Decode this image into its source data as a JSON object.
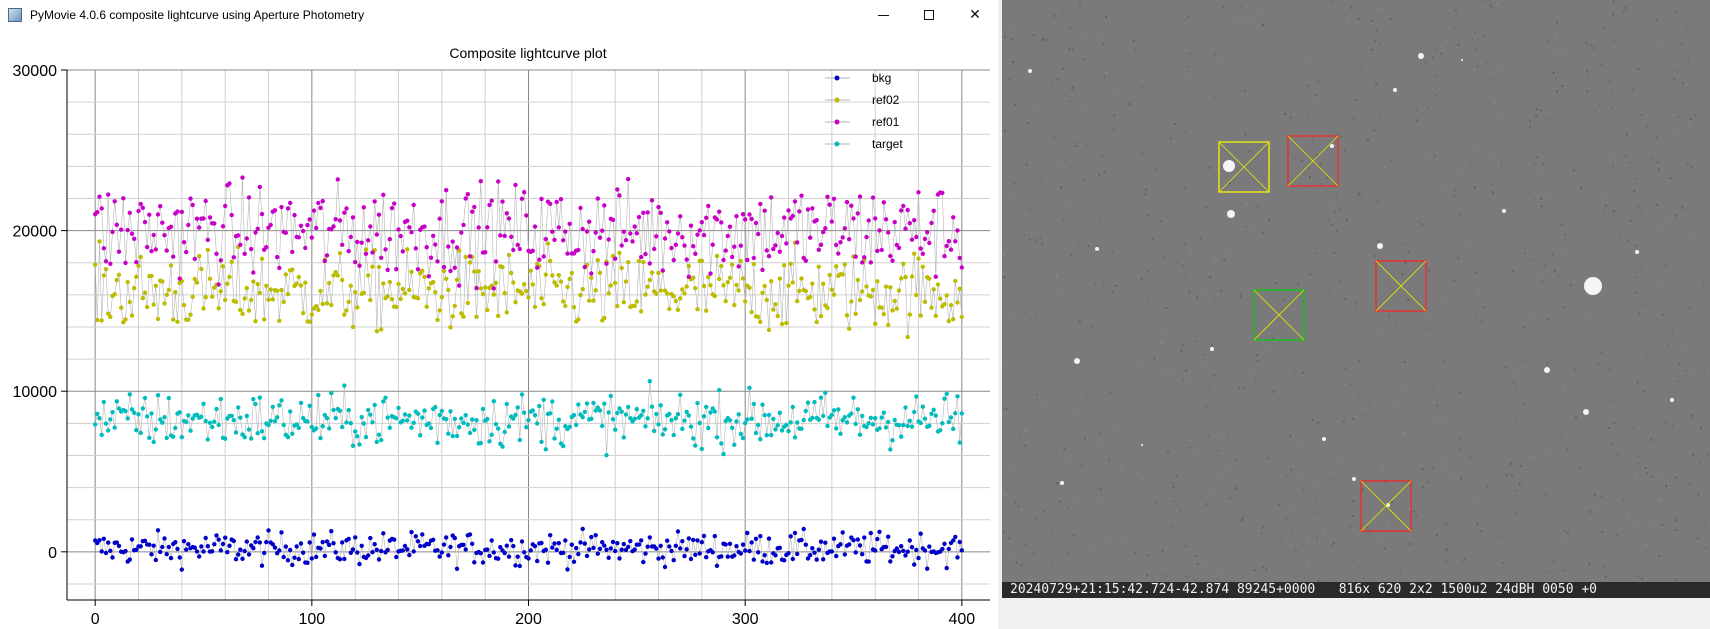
{
  "window": {
    "title": "PyMovie 4.0.6 composite lightcurve using Aperture Photometry",
    "controls": {
      "minimize": "minimize",
      "maximize": "maximize",
      "close": "✕"
    }
  },
  "chart_data": {
    "type": "scatter",
    "title": "Composite lightcurve plot",
    "xlabel": "",
    "ylabel": "",
    "xlim": [
      -13,
      413
    ],
    "ylim": [
      -3000,
      30000
    ],
    "x_ticks": [
      "0",
      "100",
      "200",
      "300",
      "400"
    ],
    "y_ticks": [
      "0",
      "10000",
      "20000",
      "30000"
    ],
    "grid": true,
    "legend_position": "top-right",
    "series": [
      {
        "name": "bkg",
        "color": "#0000c8",
        "y_min": -1500,
        "y_max": 3100,
        "mean": 200,
        "spread": 900
      },
      {
        "name": "ref02",
        "color": "#bcbc00",
        "y_min": 11000,
        "y_max": 22000,
        "mean": 16200,
        "spread": 2200
      },
      {
        "name": "ref01",
        "color": "#c800c8",
        "y_min": 14000,
        "y_max": 26500,
        "mean": 20000,
        "spread": 2600
      },
      {
        "name": "target",
        "color": "#00bcbc",
        "y_min": 4000,
        "y_max": 12500,
        "mean": 8200,
        "spread": 1500
      }
    ],
    "n_points": 401
  },
  "image": {
    "statusline": "20240729+21:15:42.724-42.874 89245+0000   816x 620 2x2 1500u2 24dBH 0050 +0",
    "apertures": [
      {
        "name": "ref",
        "color": "#ffff00"
      },
      {
        "name": "bkg-1",
        "color": "#ff2020"
      },
      {
        "name": "bkg-2",
        "color": "#ff2020"
      },
      {
        "name": "target",
        "color": "#00d000"
      },
      {
        "name": "bkg-3",
        "color": "#ff2020"
      }
    ]
  }
}
